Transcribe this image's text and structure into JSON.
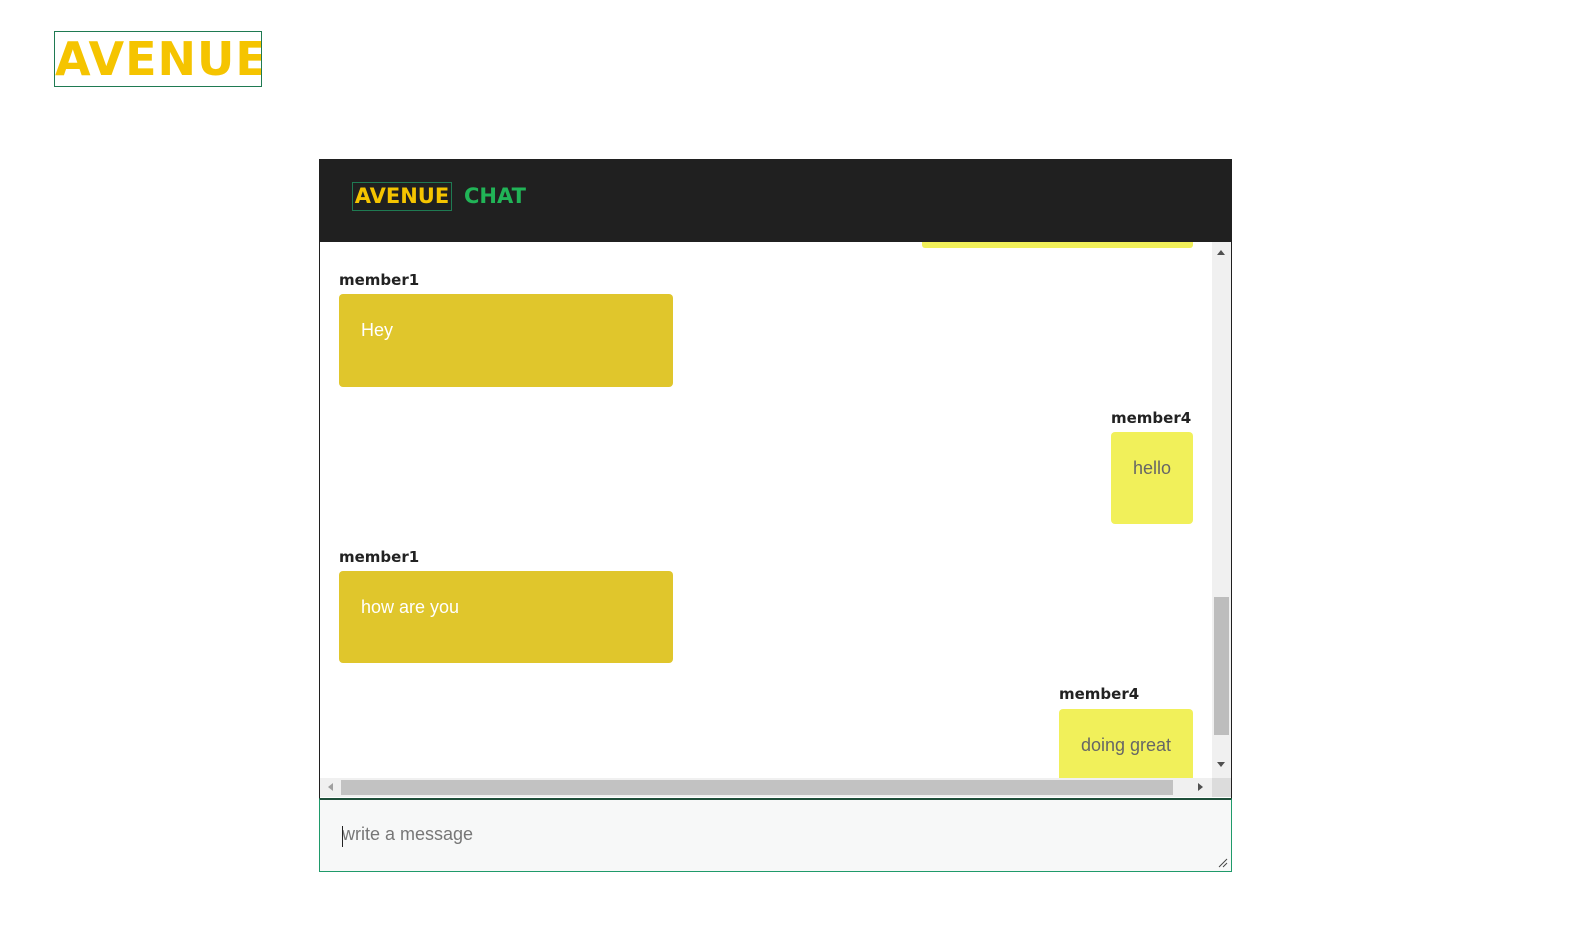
{
  "brand": {
    "logo_text": "AVENUE"
  },
  "chat": {
    "header": {
      "avenue_label": "AVENUE",
      "chat_label": "CHAT"
    },
    "messages": [
      {
        "sender": "member1",
        "text": "Hey",
        "direction": "incoming"
      },
      {
        "sender": "member4",
        "text": "hello",
        "direction": "outgoing"
      },
      {
        "sender": "member1",
        "text": "how are you",
        "direction": "incoming"
      },
      {
        "sender": "member4",
        "text": "doing great",
        "direction": "outgoing"
      }
    ],
    "composer": {
      "placeholder": "write a message",
      "value": ""
    }
  },
  "colors": {
    "brand_yellow": "#f5c400",
    "brand_green": "#21b457",
    "header_bg": "#202020",
    "incoming_bubble": "#e0c62c",
    "outgoing_bubble": "#f1f05a"
  }
}
